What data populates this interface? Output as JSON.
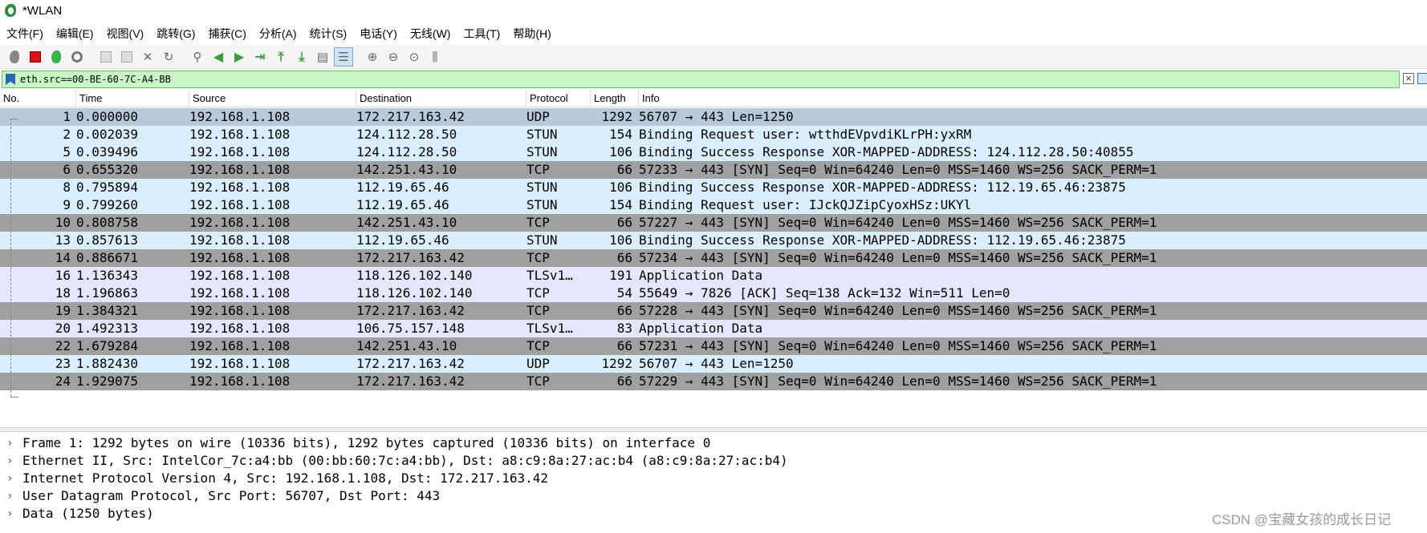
{
  "window": {
    "title": "*WLAN"
  },
  "menu": [
    "文件(F)",
    "编辑(E)",
    "视图(V)",
    "跳转(G)",
    "捕获(C)",
    "分析(A)",
    "统计(S)",
    "电话(Y)",
    "无线(W)",
    "工具(T)",
    "帮助(H)"
  ],
  "toolbar": {
    "icons": [
      "shark-fin-start-icon",
      "stop-capture-icon",
      "restart-capture-icon",
      "capture-options-icon",
      "open-file-icon",
      "save-file-icon",
      "close-file-icon",
      "reload-file-icon",
      "find-packet-icon",
      "go-back-icon",
      "go-forward-icon",
      "go-to-packet-icon",
      "go-first-icon",
      "go-last-icon",
      "autoscroll-icon",
      "colorize-icon",
      "zoom-in-icon",
      "zoom-out-icon",
      "zoom-reset-icon",
      "resize-columns-icon"
    ]
  },
  "filter": {
    "value": "eth.src==00-BE-60-7C-A4-BB",
    "clear_label": "×"
  },
  "columns": [
    "No.",
    "Time",
    "Source",
    "Destination",
    "Protocol",
    "Length",
    "Info"
  ],
  "colors": {
    "selected": "#b7c9da",
    "udp": "#daeeff",
    "tcp_syn": "#a0a0a0",
    "tls": "#e7e6ff",
    "tcp_ack": "#e7e6ff",
    "stun": "#daeeff"
  },
  "packets": [
    {
      "no": "1",
      "time": "0.000000",
      "src": "192.168.1.108",
      "dst": "172.217.163.42",
      "proto": "UDP",
      "len": "1292",
      "info": "56707 → 443 Len=1250",
      "style": "selected"
    },
    {
      "no": "2",
      "time": "0.002039",
      "src": "192.168.1.108",
      "dst": "124.112.28.50",
      "proto": "STUN",
      "len": "154",
      "info": "Binding Request user: wtthdEVpvdiKLrPH:yxRM",
      "style": "stun"
    },
    {
      "no": "5",
      "time": "0.039496",
      "src": "192.168.1.108",
      "dst": "124.112.28.50",
      "proto": "STUN",
      "len": "106",
      "info": "Binding Success Response XOR-MAPPED-ADDRESS: 124.112.28.50:40855",
      "style": "stun"
    },
    {
      "no": "6",
      "time": "0.655320",
      "src": "192.168.1.108",
      "dst": "142.251.43.10",
      "proto": "TCP",
      "len": "66",
      "info": "57233 → 443 [SYN] Seq=0 Win=64240 Len=0 MSS=1460 WS=256 SACK_PERM=1",
      "style": "tcp_syn"
    },
    {
      "no": "8",
      "time": "0.795894",
      "src": "192.168.1.108",
      "dst": "112.19.65.46",
      "proto": "STUN",
      "len": "106",
      "info": "Binding Success Response XOR-MAPPED-ADDRESS: 112.19.65.46:23875",
      "style": "stun"
    },
    {
      "no": "9",
      "time": "0.799260",
      "src": "192.168.1.108",
      "dst": "112.19.65.46",
      "proto": "STUN",
      "len": "154",
      "info": "Binding Request user: IJckQJZipCyoxHSz:UKYl",
      "style": "stun"
    },
    {
      "no": "10",
      "time": "0.808758",
      "src": "192.168.1.108",
      "dst": "142.251.43.10",
      "proto": "TCP",
      "len": "66",
      "info": "57227 → 443 [SYN] Seq=0 Win=64240 Len=0 MSS=1460 WS=256 SACK_PERM=1",
      "style": "tcp_syn"
    },
    {
      "no": "13",
      "time": "0.857613",
      "src": "192.168.1.108",
      "dst": "112.19.65.46",
      "proto": "STUN",
      "len": "106",
      "info": "Binding Success Response XOR-MAPPED-ADDRESS: 112.19.65.46:23875",
      "style": "stun"
    },
    {
      "no": "14",
      "time": "0.886671",
      "src": "192.168.1.108",
      "dst": "172.217.163.42",
      "proto": "TCP",
      "len": "66",
      "info": "57234 → 443 [SYN] Seq=0 Win=64240 Len=0 MSS=1460 WS=256 SACK_PERM=1",
      "style": "tcp_syn"
    },
    {
      "no": "16",
      "time": "1.136343",
      "src": "192.168.1.108",
      "dst": "118.126.102.140",
      "proto": "TLSv1…",
      "len": "191",
      "info": "Application Data",
      "style": "tls"
    },
    {
      "no": "18",
      "time": "1.196863",
      "src": "192.168.1.108",
      "dst": "118.126.102.140",
      "proto": "TCP",
      "len": "54",
      "info": "55649 → 7826 [ACK] Seq=138 Ack=132 Win=511 Len=0",
      "style": "tcp_ack"
    },
    {
      "no": "19",
      "time": "1.384321",
      "src": "192.168.1.108",
      "dst": "172.217.163.42",
      "proto": "TCP",
      "len": "66",
      "info": "57228 → 443 [SYN] Seq=0 Win=64240 Len=0 MSS=1460 WS=256 SACK_PERM=1",
      "style": "tcp_syn"
    },
    {
      "no": "20",
      "time": "1.492313",
      "src": "192.168.1.108",
      "dst": "106.75.157.148",
      "proto": "TLSv1…",
      "len": "83",
      "info": "Application Data",
      "style": "tls"
    },
    {
      "no": "22",
      "time": "1.679284",
      "src": "192.168.1.108",
      "dst": "142.251.43.10",
      "proto": "TCP",
      "len": "66",
      "info": "57231 → 443 [SYN] Seq=0 Win=64240 Len=0 MSS=1460 WS=256 SACK_PERM=1",
      "style": "tcp_syn"
    },
    {
      "no": "23",
      "time": "1.882430",
      "src": "192.168.1.108",
      "dst": "172.217.163.42",
      "proto": "UDP",
      "len": "1292",
      "info": "56707 → 443 Len=1250",
      "style": "udp"
    },
    {
      "no": "24",
      "time": "1.929075",
      "src": "192.168.1.108",
      "dst": "172.217.163.42",
      "proto": "TCP",
      "len": "66",
      "info": "57229 → 443 [SYN] Seq=0 Win=64240 Len=0 MSS=1460 WS=256 SACK_PERM=1",
      "style": "tcp_syn"
    }
  ],
  "details": [
    "Frame 1: 1292 bytes on wire (10336 bits), 1292 bytes captured (10336 bits) on interface 0",
    "Ethernet II, Src: IntelCor_7c:a4:bb (00:bb:60:7c:a4:bb), Dst: a8:c9:8a:27:ac:b4 (a8:c9:8a:27:ac:b4)",
    "Internet Protocol Version 4, Src: 192.168.1.108, Dst: 172.217.163.42",
    "User Datagram Protocol, Src Port: 56707, Dst Port: 443",
    "Data (1250 bytes)"
  ],
  "detail_chevron": "›",
  "watermark": "CSDN @宝藏女孩的成长日记"
}
